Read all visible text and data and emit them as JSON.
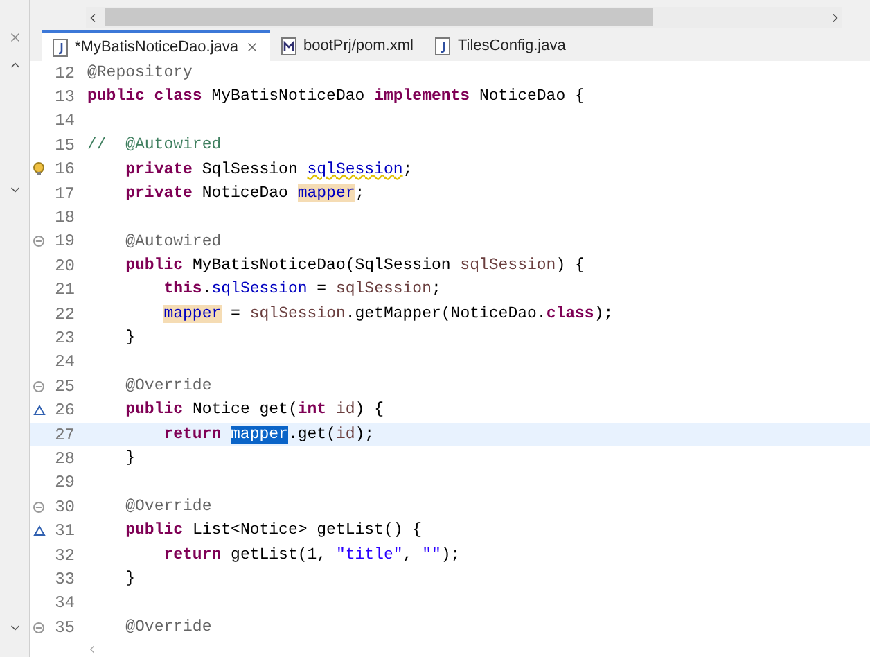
{
  "tabs": [
    {
      "label": "*MyBatisNoticeDao.java",
      "kind": "java",
      "selected": true
    },
    {
      "label": "bootPrj/pom.xml",
      "kind": "maven",
      "selected": false
    },
    {
      "label": "TilesConfig.java",
      "kind": "java",
      "selected": false
    }
  ],
  "editor": {
    "lines": [
      {
        "number": "12",
        "kind": "plain",
        "current": false,
        "tokens": [
          {
            "text": "@Repository",
            "kind": "annotation"
          }
        ]
      },
      {
        "number": "13",
        "kind": "plain",
        "current": false,
        "tokens": [
          {
            "text": "public class",
            "kind": "keyword"
          },
          {
            "text": " MyBatisNoticeDao ",
            "kind": "plain"
          },
          {
            "text": "implements",
            "kind": "keyword"
          },
          {
            "text": " NoticeDao {",
            "kind": "plain"
          }
        ]
      },
      {
        "number": "14",
        "kind": "plain",
        "current": false
      },
      {
        "number": "15",
        "kind": "plain",
        "current": false,
        "tokens": [
          {
            "text": "//  @Autowired",
            "kind": "comment"
          }
        ]
      },
      {
        "number": "16",
        "kind": "warning",
        "current": false,
        "tokens": [
          {
            "text": "    private",
            "kind": "keyword"
          },
          {
            "text": " SqlSession ",
            "kind": "plain"
          },
          {
            "text": "sqlSession",
            "kind": "warning_field"
          },
          {
            "text": ";",
            "kind": "plain"
          }
        ]
      },
      {
        "number": "17",
        "kind": "plain",
        "current": false,
        "tokens": [
          {
            "text": "    private",
            "kind": "keyword"
          },
          {
            "text": " NoticeDao ",
            "kind": "plain"
          },
          {
            "text": "mapper",
            "kind": "occurrence"
          },
          {
            "text": ";",
            "kind": "plain"
          }
        ]
      },
      {
        "number": "18",
        "kind": "plain",
        "current": false
      },
      {
        "number": "19",
        "kind": "fold",
        "current": false,
        "tokens": [
          {
            "text": "    @Autowired",
            "kind": "annotation"
          }
        ]
      },
      {
        "number": "20",
        "kind": "plain",
        "current": false,
        "tokens": [
          {
            "text": "    public",
            "kind": "keyword"
          },
          {
            "text": " MyBatisNoticeDao(SqlSession ",
            "kind": "plain"
          },
          {
            "text": "sqlSession",
            "kind": "local"
          },
          {
            "text": ") {",
            "kind": "plain"
          }
        ]
      },
      {
        "number": "21",
        "kind": "plain",
        "current": false,
        "tokens": [
          {
            "text": "        this",
            "kind": "keyword"
          },
          {
            "text": ".",
            "kind": "plain"
          },
          {
            "text": "sqlSession",
            "kind": "field"
          },
          {
            "text": " = ",
            "kind": "plain"
          },
          {
            "text": "sqlSession",
            "kind": "local"
          },
          {
            "text": ";",
            "kind": "plain"
          }
        ]
      },
      {
        "number": "22",
        "kind": "plain",
        "current": false,
        "tokens": [
          {
            "text": "        mapper",
            "kind": "occurrence"
          },
          {
            "text": " = ",
            "kind": "plain"
          },
          {
            "text": "sqlSession",
            "kind": "local"
          },
          {
            "text": ".getMapper(NoticeDao.",
            "kind": "plain"
          },
          {
            "text": "class",
            "kind": "keyword"
          },
          {
            "text": ");",
            "kind": "plain"
          }
        ]
      },
      {
        "number": "23",
        "kind": "plain",
        "current": false,
        "tokens": [
          {
            "text": "    }",
            "kind": "plain"
          }
        ]
      },
      {
        "number": "24",
        "kind": "plain",
        "current": false
      },
      {
        "number": "25",
        "kind": "fold",
        "current": false,
        "tokens": [
          {
            "text": "    @Override",
            "kind": "annotation"
          }
        ]
      },
      {
        "number": "26",
        "kind": "override",
        "current": false,
        "tokens": [
          {
            "text": "    public",
            "kind": "keyword"
          },
          {
            "text": " Notice get(",
            "kind": "plain"
          },
          {
            "text": "int",
            "kind": "keyword"
          },
          {
            "text": " id",
            "kind": "local"
          },
          {
            "text": ") {",
            "kind": "plain"
          }
        ]
      },
      {
        "number": "27",
        "kind": "plain",
        "current": true,
        "tokens": [
          {
            "text": "        return ",
            "kind": "keyword"
          },
          {
            "text": "mapper",
            "kind": "selected"
          },
          {
            "text": ".get(",
            "kind": "plain"
          },
          {
            "text": "id",
            "kind": "local"
          },
          {
            "text": ");",
            "kind": "plain"
          }
        ]
      },
      {
        "number": "28",
        "kind": "plain",
        "current": false,
        "tokens": [
          {
            "text": "    }",
            "kind": "plain"
          }
        ]
      },
      {
        "number": "29",
        "kind": "plain",
        "current": false
      },
      {
        "number": "30",
        "kind": "fold",
        "current": false,
        "tokens": [
          {
            "text": "    @Override",
            "kind": "annotation"
          }
        ]
      },
      {
        "number": "31",
        "kind": "override",
        "current": false,
        "tokens": [
          {
            "text": "    public",
            "kind": "keyword"
          },
          {
            "text": " List<Notice> getList() {",
            "kind": "plain"
          }
        ]
      },
      {
        "number": "32",
        "kind": "plain",
        "current": false,
        "tokens": [
          {
            "text": "        return",
            "kind": "keyword"
          },
          {
            "text": " getList(1, ",
            "kind": "plain"
          },
          {
            "text": "\"title\"",
            "kind": "string"
          },
          {
            "text": ", ",
            "kind": "plain"
          },
          {
            "text": "\"\"",
            "kind": "string"
          },
          {
            "text": ");",
            "kind": "plain"
          }
        ]
      },
      {
        "number": "33",
        "kind": "plain",
        "current": false,
        "tokens": [
          {
            "text": "    }",
            "kind": "plain"
          }
        ]
      },
      {
        "number": "34",
        "kind": "plain",
        "current": false
      },
      {
        "number": "35",
        "kind": "fold",
        "current": false,
        "tokens": [
          {
            "text": "    @Override",
            "kind": "annotation"
          }
        ]
      }
    ]
  }
}
